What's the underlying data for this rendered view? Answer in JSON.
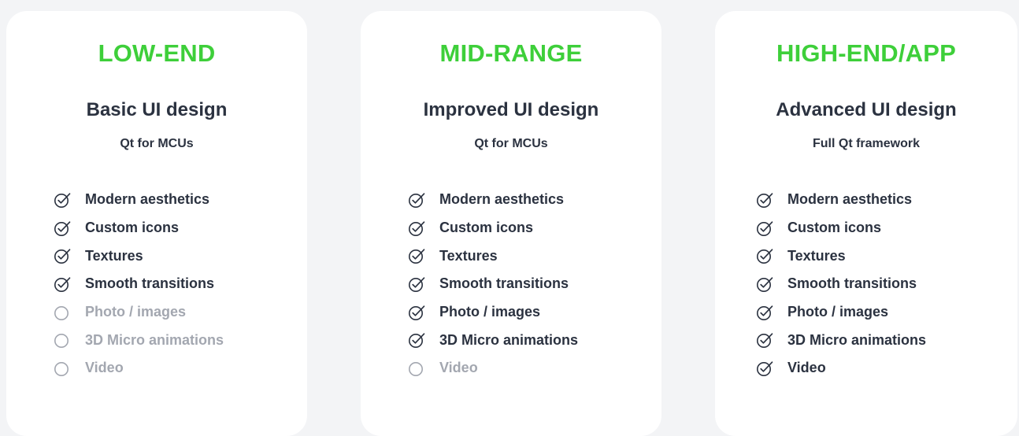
{
  "colors": {
    "accent": "#3ecf3a",
    "text": "#2b3240",
    "disabled": "#a3a7b0",
    "card": "#ffffff",
    "background": "#f3f4f6"
  },
  "icons": {
    "included": "check-circle-icon",
    "excluded": "empty-circle-icon"
  },
  "tiers": [
    {
      "tier": "LOW-END",
      "heading": "Basic UI design",
      "subheading": "Qt for MCUs",
      "features": [
        {
          "label": "Modern aesthetics",
          "included": true
        },
        {
          "label": "Custom icons",
          "included": true
        },
        {
          "label": "Textures",
          "included": true
        },
        {
          "label": "Smooth transitions",
          "included": true
        },
        {
          "label": "Photo / images",
          "included": false
        },
        {
          "label": "3D Micro animations",
          "included": false
        },
        {
          "label": "Video",
          "included": false
        }
      ]
    },
    {
      "tier": "MID-RANGE",
      "heading": "Improved UI design",
      "subheading": "Qt for MCUs",
      "features": [
        {
          "label": "Modern aesthetics",
          "included": true
        },
        {
          "label": "Custom icons",
          "included": true
        },
        {
          "label": "Textures",
          "included": true
        },
        {
          "label": "Smooth transitions",
          "included": true
        },
        {
          "label": "Photo / images",
          "included": true
        },
        {
          "label": "3D Micro animations",
          "included": true
        },
        {
          "label": "Video",
          "included": false
        }
      ]
    },
    {
      "tier": "HIGH-END/APP",
      "heading": "Advanced UI design",
      "subheading": "Full Qt framework",
      "features": [
        {
          "label": "Modern aesthetics",
          "included": true
        },
        {
          "label": "Custom icons",
          "included": true
        },
        {
          "label": "Textures",
          "included": true
        },
        {
          "label": "Smooth transitions",
          "included": true
        },
        {
          "label": "Photo / images",
          "included": true
        },
        {
          "label": "3D Micro animations",
          "included": true
        },
        {
          "label": "Video",
          "included": true
        }
      ]
    }
  ]
}
